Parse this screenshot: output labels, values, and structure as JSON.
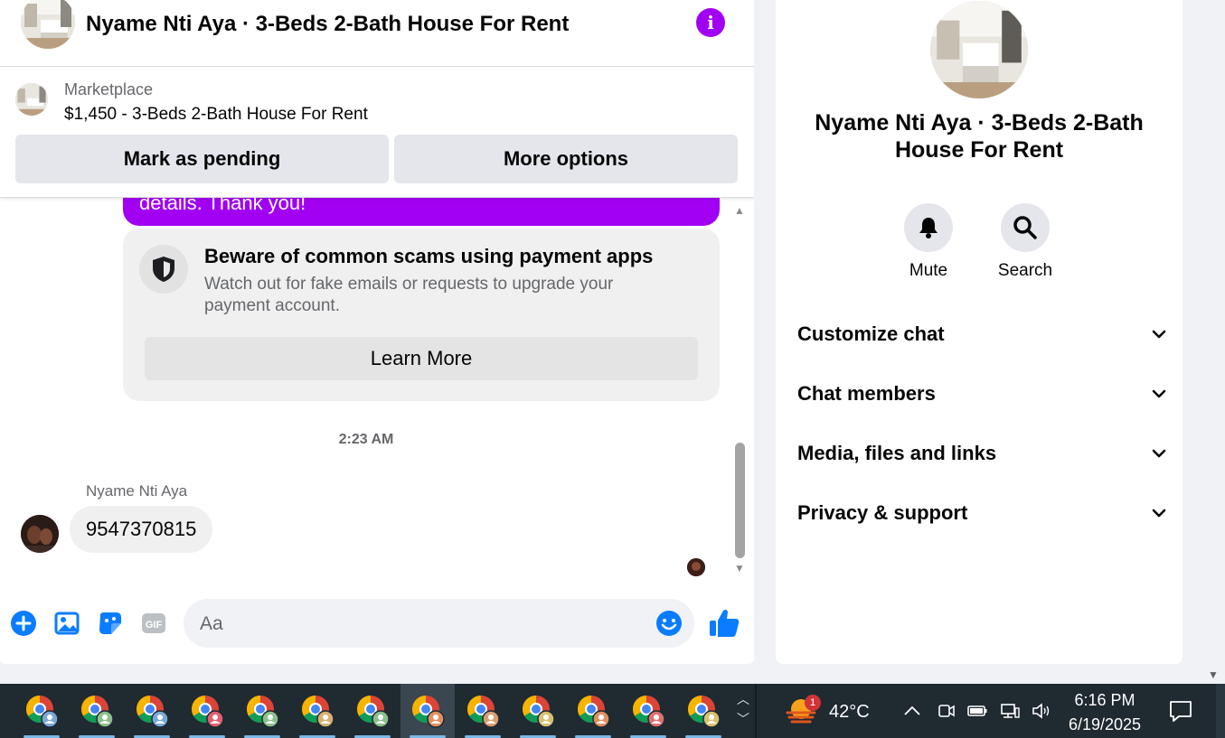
{
  "header": {
    "title": "Nyame Nti Aya · 3-Beds 2-Bath House For Rent"
  },
  "listing": {
    "label": "Marketplace",
    "price_title": "$1,450 - 3-Beds 2-Bath House For Rent",
    "mark_pending": "Mark as pending",
    "more_options": "More options"
  },
  "messages": {
    "outgoing_tail": "details. Thank you!",
    "scam_title": "Beware of common scams using payment apps",
    "scam_body": "Watch out for fake emails or requests to upgrade your payment account.",
    "learn_more": "Learn More",
    "timestamp": "2:23 AM",
    "sender_name": "Nyame Nti Aya",
    "incoming_text": "9547370815"
  },
  "composer": {
    "placeholder": "Aa"
  },
  "panel": {
    "title": "Nyame Nti Aya · 3-Beds 2-Bath House For Rent",
    "actions": [
      {
        "label": "Mute",
        "icon": "bell-icon"
      },
      {
        "label": "Search",
        "icon": "search-icon"
      }
    ],
    "sections": [
      {
        "label": "Customize chat"
      },
      {
        "label": "Chat members"
      },
      {
        "label": "Media, files and links"
      },
      {
        "label": "Privacy & support"
      }
    ]
  },
  "taskbar": {
    "weather_badge": "1",
    "temperature": "42°C",
    "time": "6:16 PM",
    "date": "6/19/2025",
    "app_count": 13
  },
  "colors": {
    "accent_purple": "#a100f2",
    "messenger_blue": "#0a7cff",
    "taskbar": "#1f2a31"
  }
}
